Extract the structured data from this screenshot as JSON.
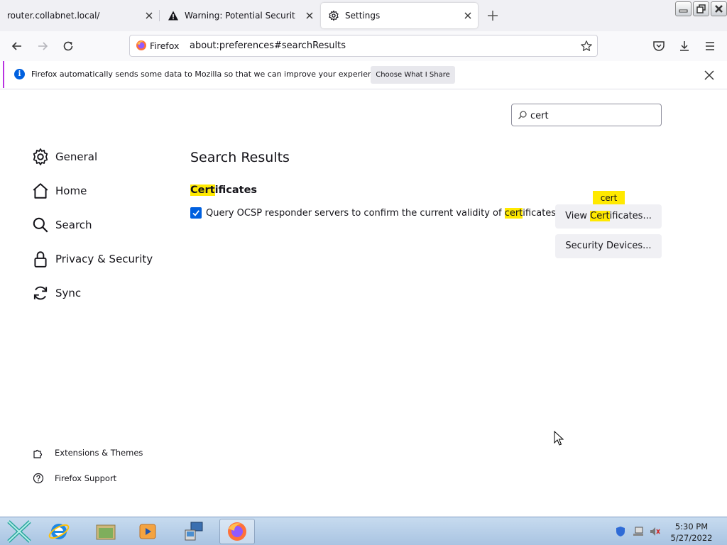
{
  "browser": {
    "tabs": [
      {
        "title": "router.collabnet.local/",
        "active": false
      },
      {
        "title": "Warning: Potential Security Risk Ahead",
        "active": false
      },
      {
        "title": "Settings",
        "active": true
      }
    ],
    "identity_label": "Firefox",
    "url": "about:preferences#searchResults"
  },
  "notification": {
    "message": "Firefox automatically sends some data to Mozilla so that we can improve your experience.",
    "button_label": "Choose What I Share"
  },
  "settings": {
    "search_value": "cert",
    "sidebar": {
      "items": [
        {
          "label": "General",
          "icon": "gear-icon"
        },
        {
          "label": "Home",
          "icon": "home-icon"
        },
        {
          "label": "Search",
          "icon": "search-icon"
        },
        {
          "label": "Privacy & Security",
          "icon": "lock-icon"
        },
        {
          "label": "Sync",
          "icon": "sync-icon"
        }
      ],
      "footer": [
        {
          "label": "Extensions & Themes",
          "icon": "puzzle-icon"
        },
        {
          "label": "Firefox Support",
          "icon": "help-icon"
        }
      ]
    },
    "results_title": "Search Results",
    "section": {
      "heading_highlight": "Cert",
      "heading_rest": "ificates",
      "checkbox": {
        "checked": true,
        "label_before": "Query OCSP responder servers to confirm the current validity of ",
        "label_highlight": "cert",
        "label_after": "ificates"
      },
      "view_button": {
        "before": "View ",
        "highlight": "Cert",
        "after": "ificates..."
      },
      "tooltip": "cert",
      "security_button": "Security Devices..."
    }
  },
  "taskbar": {
    "time": "5:30 PM",
    "date": "5/27/2022"
  },
  "colors": {
    "highlight": "#ffe900",
    "accent": "#0060df",
    "tab_bg": "#f0f0f4"
  }
}
